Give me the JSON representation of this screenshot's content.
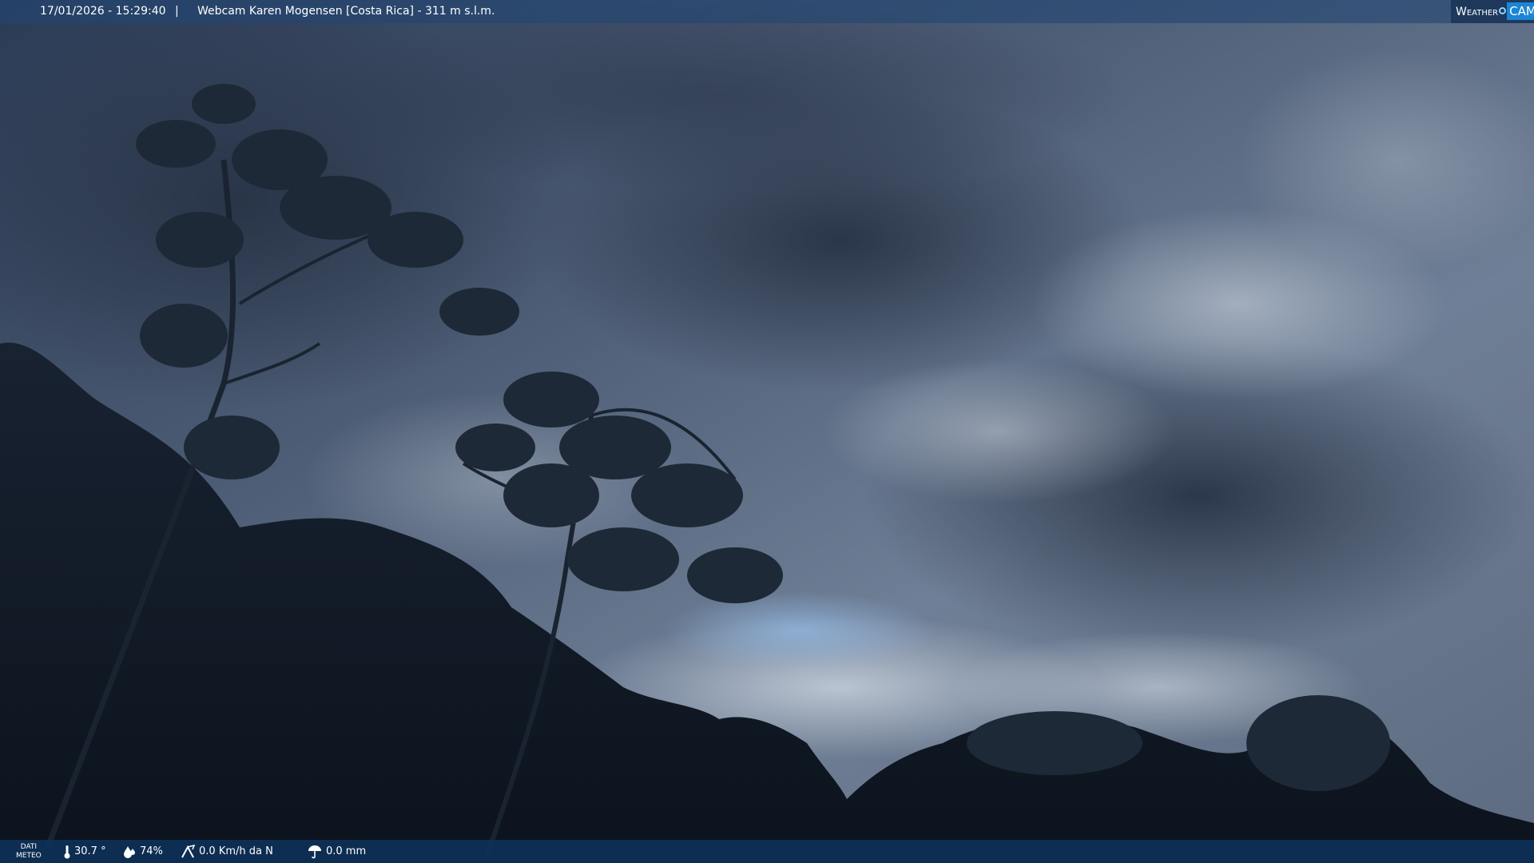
{
  "header": {
    "timestamp": "17/01/2026 - 15:29:40",
    "separator": "|",
    "caption": "Webcam Karen Mogensen [Costa Rica]  - 311 m s.l.m."
  },
  "logo": {
    "word": "Weather",
    "cam": "CAM"
  },
  "weather": {
    "label_line1": "DATI",
    "label_line2": "METEO",
    "temperature": "30.7 °",
    "humidity": "74%",
    "wind": "0.0 Km/h da N",
    "rain": "0.0 mm"
  },
  "icons": {
    "temperature": "thermometer-icon",
    "humidity": "humidity-drop-icon",
    "wind": "wind-icon",
    "rain": "rain-gauge-icon"
  },
  "colors": {
    "bar": "#224673",
    "bottom_bar": "#0e325c",
    "logo_accent": "#1c86d6"
  }
}
